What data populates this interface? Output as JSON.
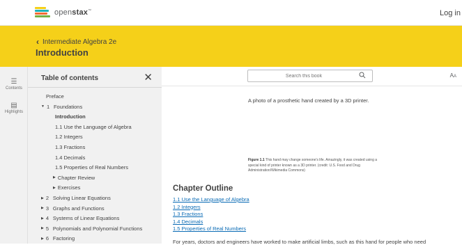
{
  "header": {
    "logo_text_light": "open",
    "logo_text_bold": "stax",
    "logo_tm": "™",
    "login_label": "Log in",
    "logo_colors": [
      "#f4d019",
      "#21b1b7",
      "#f36b32",
      "#77af42",
      "#0dc0dc"
    ]
  },
  "hero": {
    "breadcrumb": "Intermediate Algebra 2e",
    "title": "Introduction",
    "background": "#f5d019"
  },
  "rail": {
    "contents_label": "Contents",
    "highlights_label": "Highlights"
  },
  "toc": {
    "title": "Table of contents",
    "items": [
      {
        "label": "Preface",
        "num": "",
        "tri": "",
        "level": 0,
        "bold": false
      },
      {
        "label": "Foundations",
        "num": "1",
        "tri": "▼",
        "level": 0,
        "bold": false
      },
      {
        "label": "Introduction",
        "num": "",
        "tri": "",
        "level": 1,
        "bold": true
      },
      {
        "label": "1.1  Use the Language of Algebra",
        "num": "",
        "tri": "",
        "level": 1,
        "bold": false
      },
      {
        "label": "1.2  Integers",
        "num": "",
        "tri": "",
        "level": 1,
        "bold": false
      },
      {
        "label": "1.3  Fractions",
        "num": "",
        "tri": "",
        "level": 1,
        "bold": false
      },
      {
        "label": "1.4  Decimals",
        "num": "",
        "tri": "",
        "level": 1,
        "bold": false
      },
      {
        "label": "1.5  Properties of Real Numbers",
        "num": "",
        "tri": "",
        "level": 1,
        "bold": false
      },
      {
        "label": "Chapter Review",
        "num": "",
        "tri": "▶",
        "level": 1,
        "bold": false
      },
      {
        "label": "Exercises",
        "num": "",
        "tri": "▶",
        "level": 1,
        "bold": false
      },
      {
        "label": "Solving Linear Equations",
        "num": "2",
        "tri": "▶",
        "level": 0,
        "bold": false
      },
      {
        "label": "Graphs and Functions",
        "num": "3",
        "tri": "▶",
        "level": 0,
        "bold": false
      },
      {
        "label": "Systems of Linear Equations",
        "num": "4",
        "tri": "▶",
        "level": 0,
        "bold": false
      },
      {
        "label": "Polynomials and Polynomial Functions",
        "num": "5",
        "tri": "▶",
        "level": 0,
        "bold": false
      },
      {
        "label": "Factoring",
        "num": "6",
        "tri": "▶",
        "level": 0,
        "bold": false
      }
    ]
  },
  "search": {
    "placeholder": "Search this book"
  },
  "content": {
    "image_alt": "A photo of a prosthetic hand created by a 3D printer.",
    "figure_label": "Figure 1.1",
    "figure_caption": " This hand may change someone's life. Amazingly, it was created using a special kind of printer known as a 3D printer. (credit: U.S. Food and Drug Administration/Wikimedia Commons)",
    "outline_heading": "Chapter Outline",
    "outline_links": [
      "1.1 Use the Language of Algebra",
      "1.2 Integers",
      "1.3 Fractions",
      "1.4 Decimals",
      "1.5 Properties of Real Numbers"
    ],
    "body_text": "For years, doctors and engineers have worked to make artificial limbs, such as this hand for people who need"
  }
}
